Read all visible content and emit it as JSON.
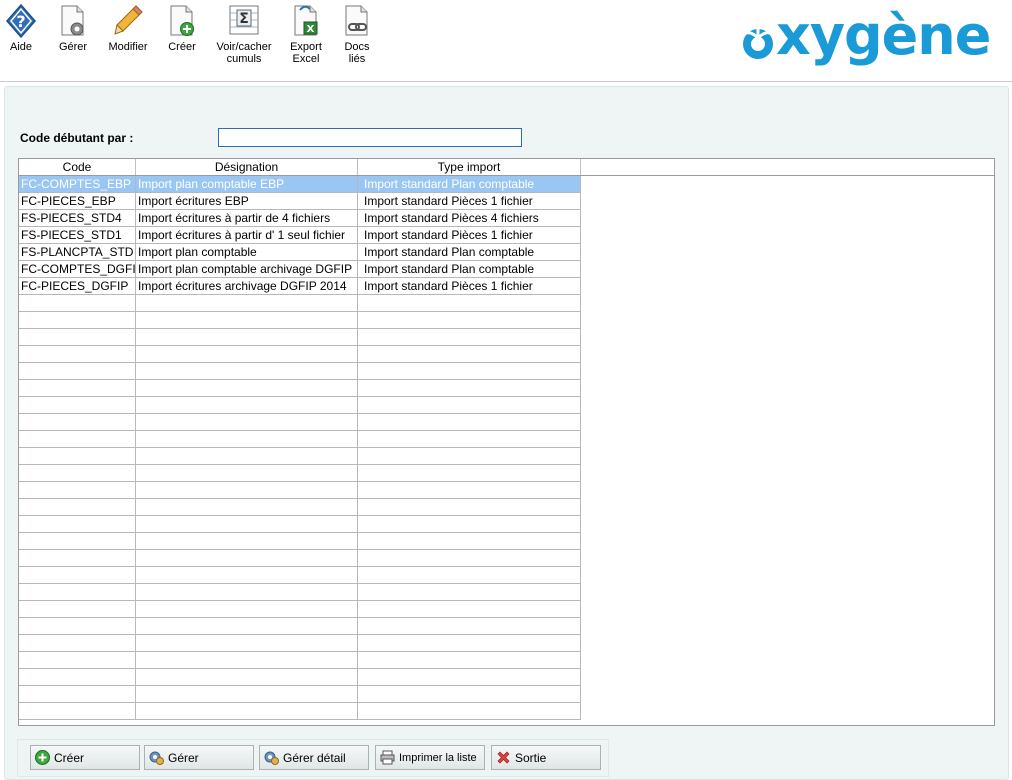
{
  "toolbar": {
    "items": [
      {
        "label": "Aide",
        "icon": "help-diamond-icon"
      },
      {
        "label": "Gérer",
        "icon": "document-gear-icon"
      },
      {
        "label": "Modifier",
        "icon": "pencil-icon"
      },
      {
        "label": "Créer",
        "icon": "document-plus-icon"
      },
      {
        "label": "Voir/cacher cumuls",
        "icon": "sigma-sheet-icon"
      },
      {
        "label": "Export Excel",
        "icon": "excel-export-icon"
      },
      {
        "label": "Docs liés",
        "icon": "linked-docs-icon"
      }
    ]
  },
  "logo": {
    "text": "xygène",
    "color": "#1a9ad6"
  },
  "filter": {
    "label": "Code débutant par :",
    "value": ""
  },
  "table": {
    "columns": [
      "Code",
      "Désignation",
      "Type import"
    ],
    "rows": [
      [
        "FC-COMPTES_EBP",
        "Import plan comptable EBP",
        "Import standard Plan comptable"
      ],
      [
        "FC-PIECES_EBP",
        "Import écritures EBP",
        "Import standard Pièces 1 fichier"
      ],
      [
        "FS-PIECES_STD4",
        "Import écritures à partir de 4 fichiers",
        "Import standard Pièces 4 fichiers"
      ],
      [
        "FS-PIECES_STD1",
        "Import écritures à partir d' 1 seul fichier",
        "Import standard Pièces 1 fichier"
      ],
      [
        "FS-PLANCPTA_STD",
        "Import plan comptable",
        "Import standard Plan comptable"
      ],
      [
        "FC-COMPTES_DGFIP",
        "Import plan comptable archivage DGFIP",
        "Import standard Plan comptable"
      ],
      [
        "FC-PIECES_DGFIP",
        "Import écritures archivage DGFIP 2014",
        "Import standard Pièces 1 fichier"
      ]
    ],
    "selected_row": 0,
    "selection_color": "#99c6f2"
  },
  "buttons": {
    "create": "Créer",
    "manage": "Gérer",
    "manage_detail": "Gérer détail",
    "print_list": "Imprimer la liste",
    "exit": "Sortie"
  }
}
